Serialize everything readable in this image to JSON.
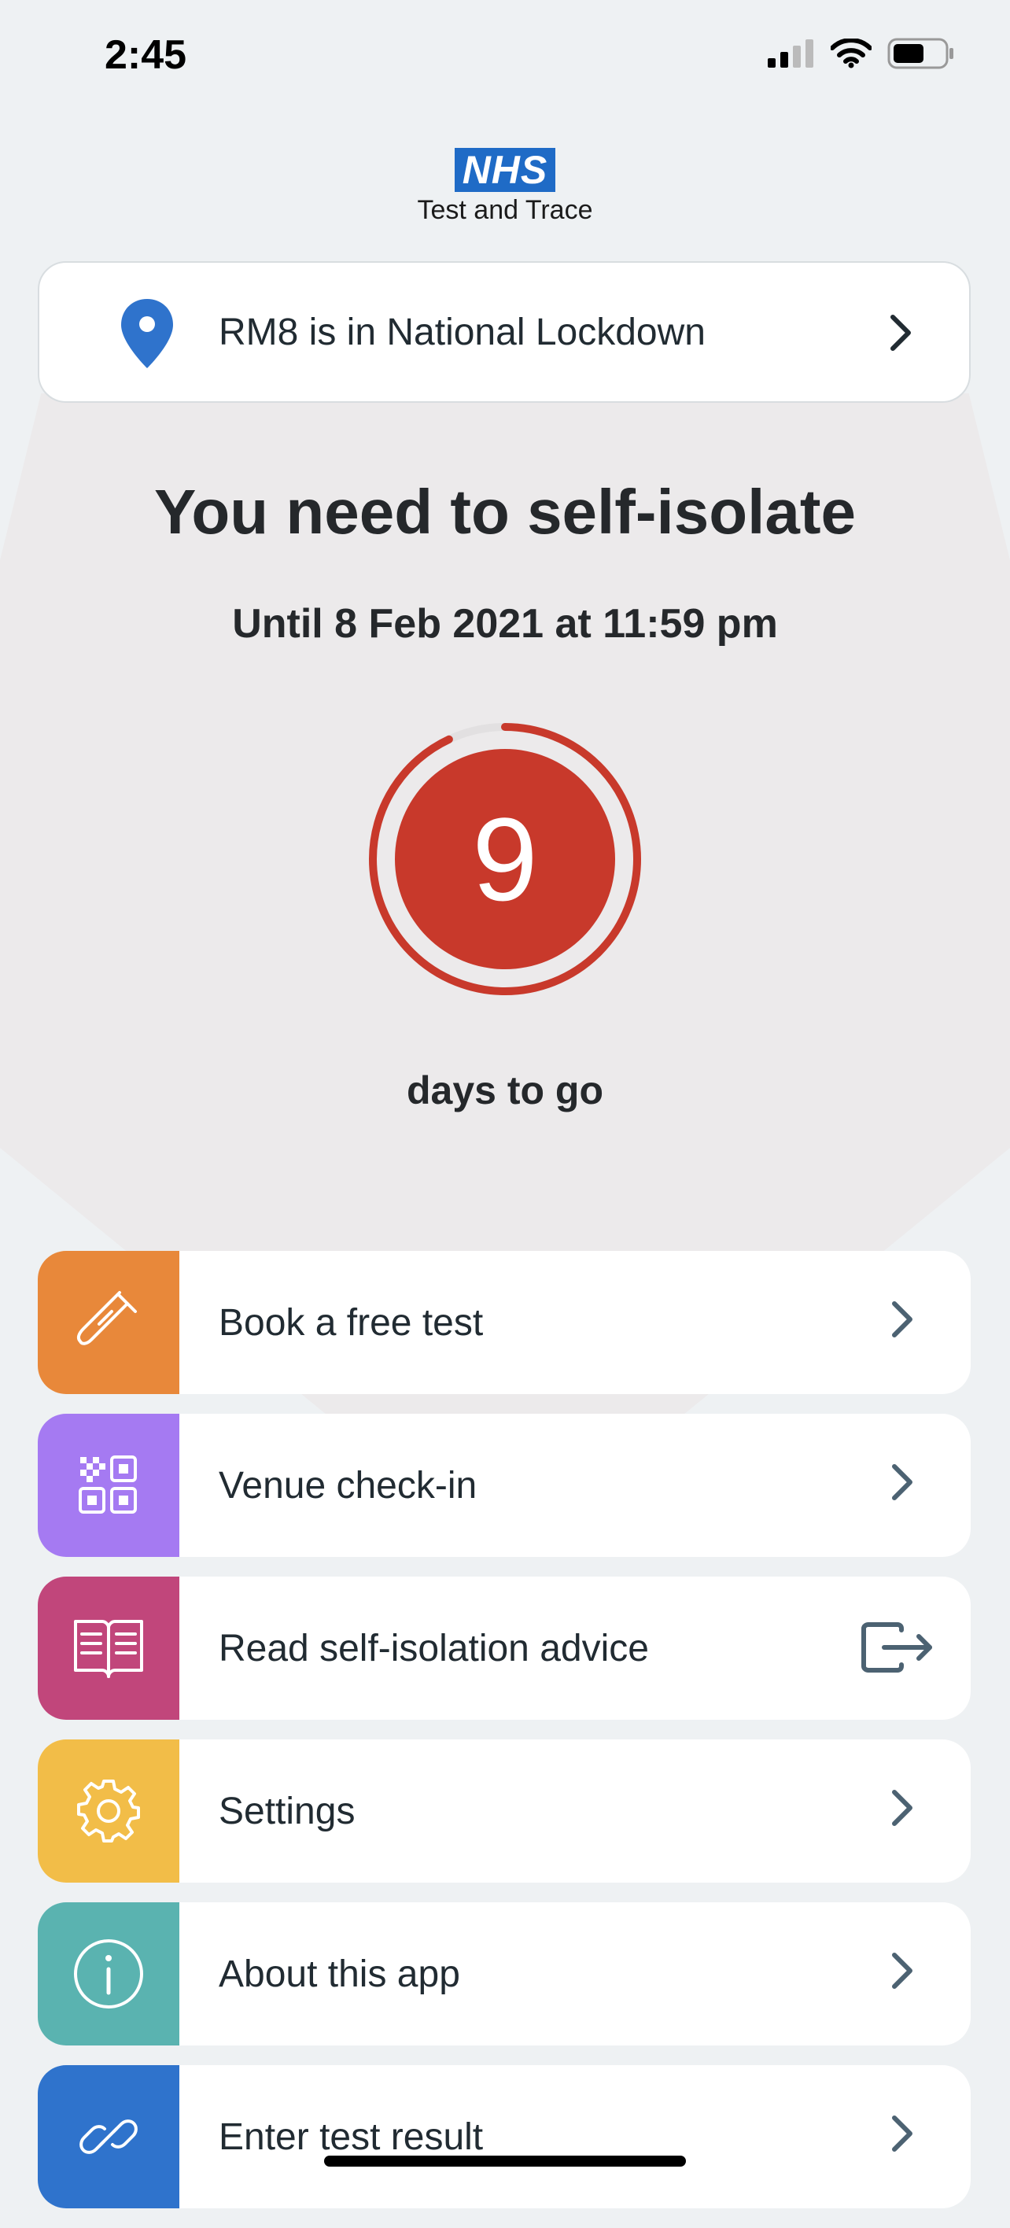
{
  "status_bar": {
    "time": "2:45"
  },
  "header": {
    "logo": "NHS",
    "subtitle": "Test and Trace"
  },
  "area_banner": {
    "text": "RM8 is in National Lockdown",
    "icon": "location-pin-icon"
  },
  "isolation": {
    "title": "You need to self-isolate",
    "until": "Until 8 Feb 2021 at 11:59 pm",
    "days_remaining": "9",
    "days_label": "days to go",
    "countdown_fraction": 0.93
  },
  "menu": [
    {
      "label": "Book a free test",
      "icon": "test-tube-icon",
      "color": "#e8883a",
      "trail": "chevron-right-icon"
    },
    {
      "label": "Venue check-in",
      "icon": "qr-code-icon",
      "color": "#a57af2",
      "trail": "chevron-right-icon"
    },
    {
      "label": "Read self-isolation advice",
      "icon": "book-icon",
      "color": "#c1467b",
      "trail": "external-link-icon"
    },
    {
      "label": "Settings",
      "icon": "gear-icon",
      "color": "#f2bd48",
      "trail": "chevron-right-icon"
    },
    {
      "label": "About this app",
      "icon": "info-icon",
      "color": "#5ab3b0",
      "trail": "chevron-right-icon"
    },
    {
      "label": "Enter test result",
      "icon": "link-icon",
      "color": "#2f73cc",
      "trail": "chevron-right-icon"
    }
  ],
  "colors": {
    "accent_red": "#c8392b",
    "nhs_blue": "#1f6bc6",
    "background": "#eef1f3"
  }
}
